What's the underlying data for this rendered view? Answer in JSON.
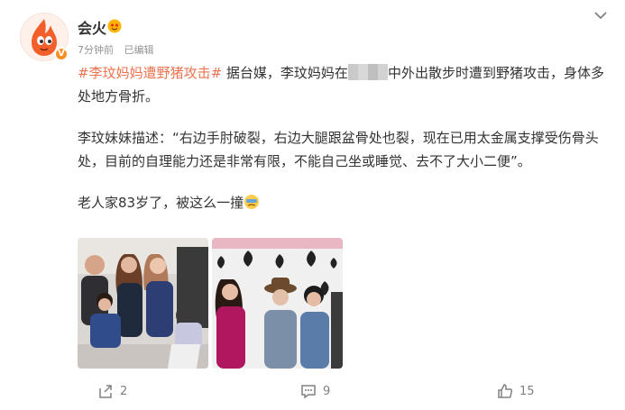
{
  "user": {
    "name": "会火",
    "verified_mark": "V"
  },
  "meta": {
    "time": "7分钟前",
    "edited": "已编辑"
  },
  "post": {
    "hashtag": "#李玟妈妈遭野猪攻击#",
    "p1_a": "据台媒，李玟妈妈在",
    "p1_b": "中外出散步时遭到野猪攻击，身体多处地方骨折。",
    "p2": "李玟妹妹描述：“右边手肘破裂，右边大腿跟盆骨处也裂，现在已用太金属支撑受伤骨头处，目前的自理能力还是非常有限，不能自己坐或睡觉、去不了大小二便”。",
    "p3": "老人家83岁了，被这么一撞"
  },
  "footer": {
    "share_count": "2",
    "comment_count": "9",
    "like_count": "15"
  },
  "colors": {
    "accent": "#eb7350",
    "text": "#333333",
    "meta": "#939393",
    "icon": "#808080"
  },
  "icons": [
    "more-chevron",
    "share",
    "comment",
    "like",
    "emoji-face"
  ]
}
